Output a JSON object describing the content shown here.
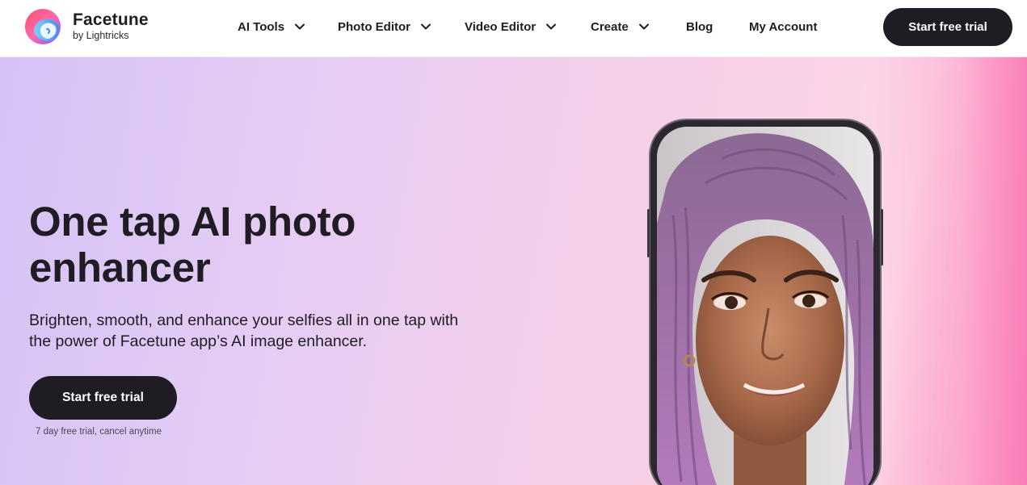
{
  "brand": {
    "name": "Facetune",
    "byline": "by Lightricks"
  },
  "nav": {
    "items": [
      {
        "label": "AI Tools",
        "has_dropdown": true
      },
      {
        "label": "Photo Editor",
        "has_dropdown": true
      },
      {
        "label": "Video Editor",
        "has_dropdown": true
      },
      {
        "label": "Create",
        "has_dropdown": true
      },
      {
        "label": "Blog",
        "has_dropdown": false
      },
      {
        "label": "My Account",
        "has_dropdown": false
      }
    ]
  },
  "header": {
    "cta_label": "Start free trial"
  },
  "hero": {
    "title": "One tap AI photo enhancer",
    "subtitle": "Brighten, smooth, and enhance your selfies all in one tap with the power of Facetune app’s AI image enhancer.",
    "cta_label": "Start free trial",
    "trial_note": "7 day free trial, cancel anytime"
  },
  "colors": {
    "dark": "#1f1c24",
    "hero_gradient_start": "#d6c2f7",
    "hero_gradient_end": "#fb94c4"
  },
  "icons": {
    "logo": "facetune-logo-icon",
    "dropdown": "chevron-down-icon"
  }
}
